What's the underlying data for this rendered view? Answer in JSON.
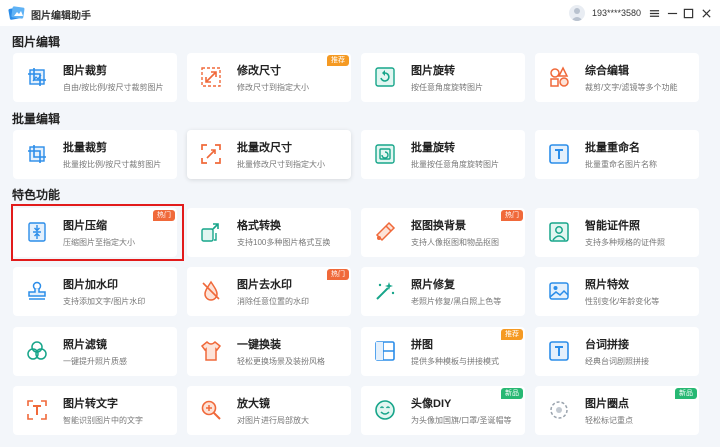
{
  "app": {
    "title": "图片编辑助手",
    "user": "193****3580"
  },
  "sections": {
    "image_edit": "图片编辑",
    "batch_edit": "批量编辑",
    "special": "特色功能"
  },
  "cards": {
    "crop": {
      "title": "图片裁剪",
      "desc": "自由/按比例/按尺寸裁剪图片"
    },
    "resize": {
      "title": "修改尺寸",
      "desc": "修改尺寸到指定大小",
      "badge": "推荐"
    },
    "rotate": {
      "title": "图片旋转",
      "desc": "按任意角度旋转图片"
    },
    "composite": {
      "title": "综合编辑",
      "desc": "裁剪/文字/滤镜等多个功能"
    },
    "batch_crop": {
      "title": "批量裁剪",
      "desc": "批量按比例/按尺寸裁剪图片"
    },
    "batch_resize": {
      "title": "批量改尺寸",
      "desc": "批量修改尺寸到指定大小"
    },
    "batch_rotate": {
      "title": "批量旋转",
      "desc": "批量按任意角度旋转图片"
    },
    "batch_rename": {
      "title": "批量重命名",
      "desc": "批量重命名图片名称"
    },
    "compress": {
      "title": "图片压缩",
      "desc": "压缩图片至指定大小",
      "badge": "热门"
    },
    "convert": {
      "title": "格式转换",
      "desc": "支持100多种图片格式互换"
    },
    "cutout": {
      "title": "抠图换背景",
      "desc": "支持人像抠图和物品抠图",
      "badge": "热门"
    },
    "id_photo": {
      "title": "智能证件照",
      "desc": "支持多种规格的证件照"
    },
    "watermark_add": {
      "title": "图片加水印",
      "desc": "支持添加文字/图片水印"
    },
    "watermark_remove": {
      "title": "图片去水印",
      "desc": "消除任意位置的水印",
      "badge": "热门"
    },
    "restore": {
      "title": "照片修复",
      "desc": "老照片修复/黑白照上色等"
    },
    "effects": {
      "title": "照片特效",
      "desc": "性别变化/年龄变化等"
    },
    "filter": {
      "title": "照片滤镜",
      "desc": "一键提升照片质感"
    },
    "outfit": {
      "title": "一键换装",
      "desc": "轻松更换场景及装扮风格"
    },
    "collage": {
      "title": "拼图",
      "desc": "提供多种模板与拼接模式",
      "badge": "推荐"
    },
    "lines_stitch": {
      "title": "台词拼接",
      "desc": "经典台词剧照拼接"
    },
    "ocr": {
      "title": "图片转文字",
      "desc": "智能识别图片中的文字"
    },
    "magnifier": {
      "title": "放大镜",
      "desc": "对图片进行局部放大"
    },
    "avatar_diy": {
      "title": "头像DIY",
      "desc": "为头像加国旗/口罩/圣诞帽等",
      "badge": "新品"
    },
    "marker": {
      "title": "图片圈点",
      "desc": "轻松标记重点",
      "badge": "新品"
    }
  },
  "colors": {
    "accent": "#2b8de9",
    "orange": "#f0693a",
    "highlight": "#e21b1b"
  }
}
